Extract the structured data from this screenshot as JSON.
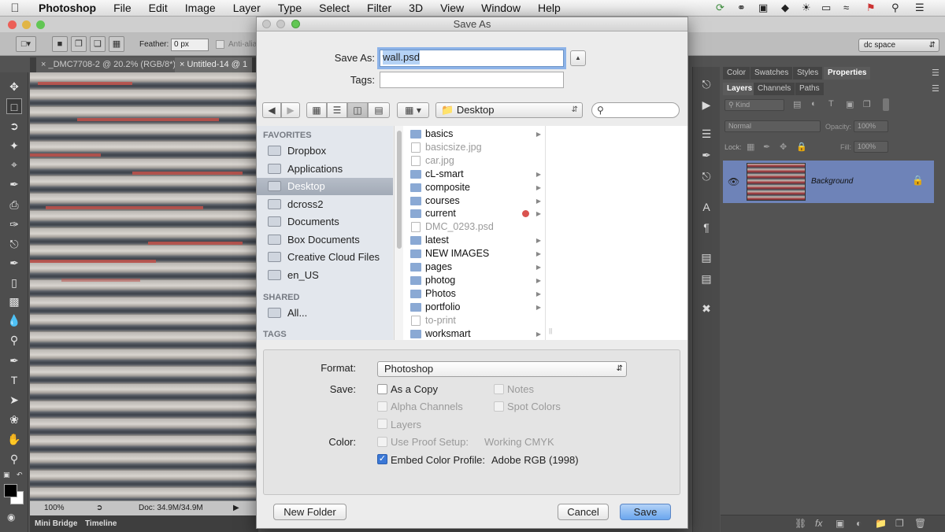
{
  "menubar": {
    "app": "Photoshop",
    "items": [
      "File",
      "Edit",
      "Image",
      "Layer",
      "Type",
      "Select",
      "Filter",
      "3D",
      "View",
      "Window",
      "Help"
    ]
  },
  "options_bar": {
    "feather_label": "Feather:",
    "feather_value": "0 px",
    "anti_alias_label": "Anti-alia",
    "workspace": "dc space"
  },
  "doc_tabs": [
    {
      "label": "_DMC7708-2 @ 20.2% (RGB/8*)"
    },
    {
      "label": "Untitled-14 @ 1"
    }
  ],
  "statusbar": {
    "zoom": "100%",
    "doc": "Doc: 34.9M/34.9M"
  },
  "bottom_tabs": [
    "Mini Bridge",
    "Timeline"
  ],
  "panels": {
    "top_tabs": [
      "Color",
      "Swatches",
      "Styles",
      "Properties"
    ],
    "layer_tabs": [
      "Layers",
      "Channels",
      "Paths"
    ],
    "kind_label": "Kind",
    "blend_mode": "Normal",
    "opacity_label": "Opacity:",
    "opacity_value": "100%",
    "lock_label": "Lock:",
    "fill_label": "Fill:",
    "fill_value": "100%",
    "layer_name": "Background"
  },
  "dialog": {
    "title": "Save As",
    "save_as_label": "Save As:",
    "filename": "wall.psd",
    "tags_label": "Tags:",
    "location": "Desktop",
    "sidebar": {
      "favorites_header": "FAVORITES",
      "favorites": [
        {
          "label": "Dropbox"
        },
        {
          "label": "Applications"
        },
        {
          "label": "Desktop",
          "selected": true
        },
        {
          "label": "dcross2"
        },
        {
          "label": "Documents"
        },
        {
          "label": "Box Documents"
        },
        {
          "label": "Creative Cloud Files"
        },
        {
          "label": "en_US"
        }
      ],
      "shared_header": "SHARED",
      "shared": [
        {
          "label": "All..."
        }
      ],
      "tags_header": "TAGS"
    },
    "files": [
      {
        "name": "basics",
        "folder": true,
        "enabled": true
      },
      {
        "name": "basicsize.jpg",
        "folder": false,
        "enabled": false
      },
      {
        "name": "car.jpg",
        "folder": false,
        "enabled": false
      },
      {
        "name": "cL-smart",
        "folder": true,
        "enabled": true
      },
      {
        "name": "composite",
        "folder": true,
        "enabled": true
      },
      {
        "name": "courses",
        "folder": true,
        "enabled": true
      },
      {
        "name": "current",
        "folder": true,
        "enabled": true,
        "tag": "#d9534f"
      },
      {
        "name": "DMC_0293.psd",
        "folder": false,
        "enabled": false
      },
      {
        "name": "latest",
        "folder": true,
        "enabled": true
      },
      {
        "name": "NEW IMAGES",
        "folder": true,
        "enabled": true
      },
      {
        "name": "pages",
        "folder": true,
        "enabled": true
      },
      {
        "name": "photog",
        "folder": true,
        "enabled": true
      },
      {
        "name": "Photos",
        "folder": true,
        "enabled": true
      },
      {
        "name": "portfolio",
        "folder": true,
        "enabled": true
      },
      {
        "name": "to-print",
        "folder": false,
        "enabled": false
      },
      {
        "name": "worksmart",
        "folder": true,
        "enabled": true
      }
    ],
    "format_label": "Format:",
    "format_value": "Photoshop",
    "save_label": "Save:",
    "options": {
      "as_a_copy": "As a Copy",
      "notes": "Notes",
      "alpha_channels": "Alpha Channels",
      "spot_colors": "Spot Colors",
      "layers": "Layers"
    },
    "color_label": "Color:",
    "use_proof_setup": "Use Proof Setup:",
    "proof_profile": "Working CMYK",
    "embed_color_profile": "Embed Color Profile:",
    "color_profile": "Adobe RGB (1998)",
    "new_folder_button": "New Folder",
    "cancel_button": "Cancel",
    "save_button": "Save"
  }
}
